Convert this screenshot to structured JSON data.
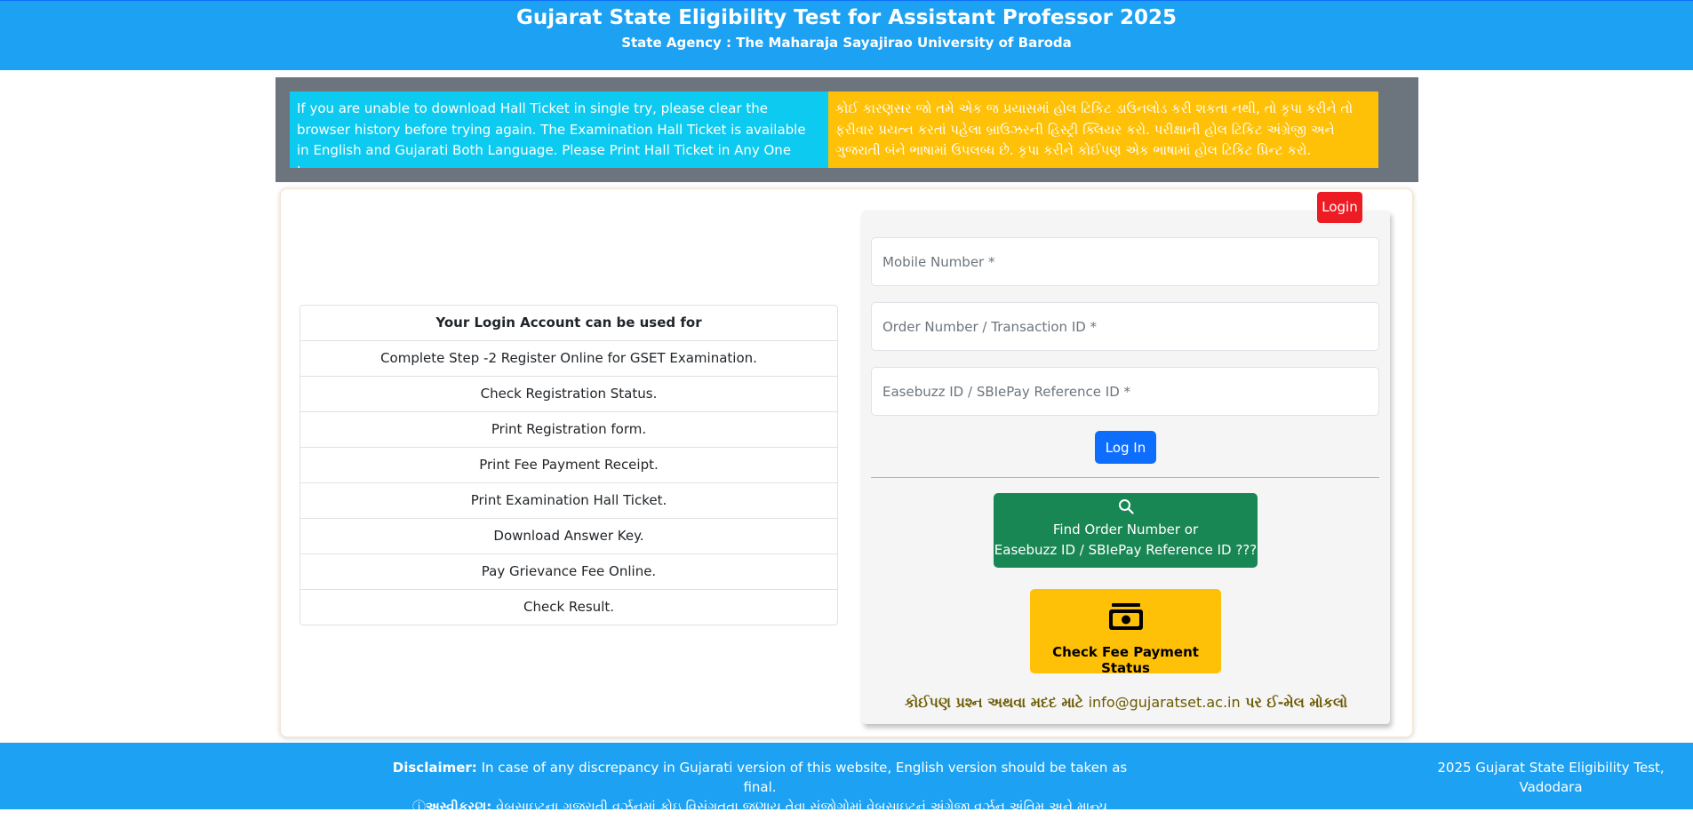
{
  "header": {
    "title": "Gujarat State Eligibility Test for Assistant Professor 2025",
    "subtitle": "State Agency : The Maharaja Sayajirao University of Baroda"
  },
  "notice": {
    "english": "If you are unable to download Hall Ticket in single try, please clear the browser history before trying again. The Examination Hall Ticket is available in English and Gujarati Both Language. Please Print Hall Ticket in Any One Language.",
    "gujarati": "કોઈ કારણસર જો તમે એક જ પ્રયાસમાં હોલ ટિકિટ ડાઉનલોડ કરી શકતા નથી, તો કૃપા કરીને તો ફરીવાર પ્રયત્ન કરતાં પહેલા બ્રાઉઝરની હિસ્ટ્રી ક્લિયર કરો. પરીક્ષાની હોલ ટિકિટ અંગ્રેજી અને ગુજરાતી બંને ભાષામાં ઉપલબ્ધ છે. કૃપા કરીને કોઈપણ એક ભાષામાં હોલ ટિકિટ પ્રિન્ટ કરો."
  },
  "uses": {
    "heading": "Your Login Account can be used for",
    "items": [
      "Complete Step -2 Register Online for GSET Examination.",
      "Check Registration Status.",
      "Print Registration form.",
      "Print Fee Payment Receipt.",
      "Print Examination Hall Ticket.",
      "Download Answer Key.",
      "Pay Grievance Fee Online.",
      "Check Result."
    ]
  },
  "login": {
    "badge": "Login",
    "mobile_placeholder": "Mobile Number *",
    "order_placeholder": "Order Number / Transaction ID *",
    "easebuzz_placeholder": "Easebuzz ID / SBIePay Reference ID *",
    "login_button": "Log In",
    "find_line1": "Find Order Number or",
    "find_line2": "Easebuzz ID / SBIePay Reference ID ???",
    "fee_status_button": "Check Fee Payment Status",
    "contact_prefix": "કોઈપણ પ્રશ્ન અથવા મદદ માટે ",
    "contact_email": "info@gujaratset.ac.in",
    "contact_suffix": " પર ઈ-મેલ મોકલો"
  },
  "icons": {
    "find": "search-icon",
    "fee": "money-icon"
  },
  "footer": {
    "disclaimer_label": "Disclaimer:",
    "disclaimer_text": " In case of any discrepancy in Gujarati version of this website, English version should be taken as final.",
    "gujarati_label": "અસ્વીકરણ:",
    "gujarati_text": " વેબસાઇટના ગુજરાતી વર્ઝનમાં કોઇ વિસંગતતા જણાય તેવા સંજોગોમાં વેબસાઇટનું અંગ્રેજી વર્ઝન અંતિમ અને માન્ય રાખવામા આવશે.",
    "copyright_line1": "2025 Gujarat State Eligibility Test,",
    "copyright_line2": "Vadodara"
  },
  "colors": {
    "header_bg": "#1da1f2",
    "info_cyan": "#0dcaf0",
    "info_yellow": "#ffc107",
    "primary": "#0d6efd",
    "success": "#198754",
    "danger": "#ed1c24"
  }
}
